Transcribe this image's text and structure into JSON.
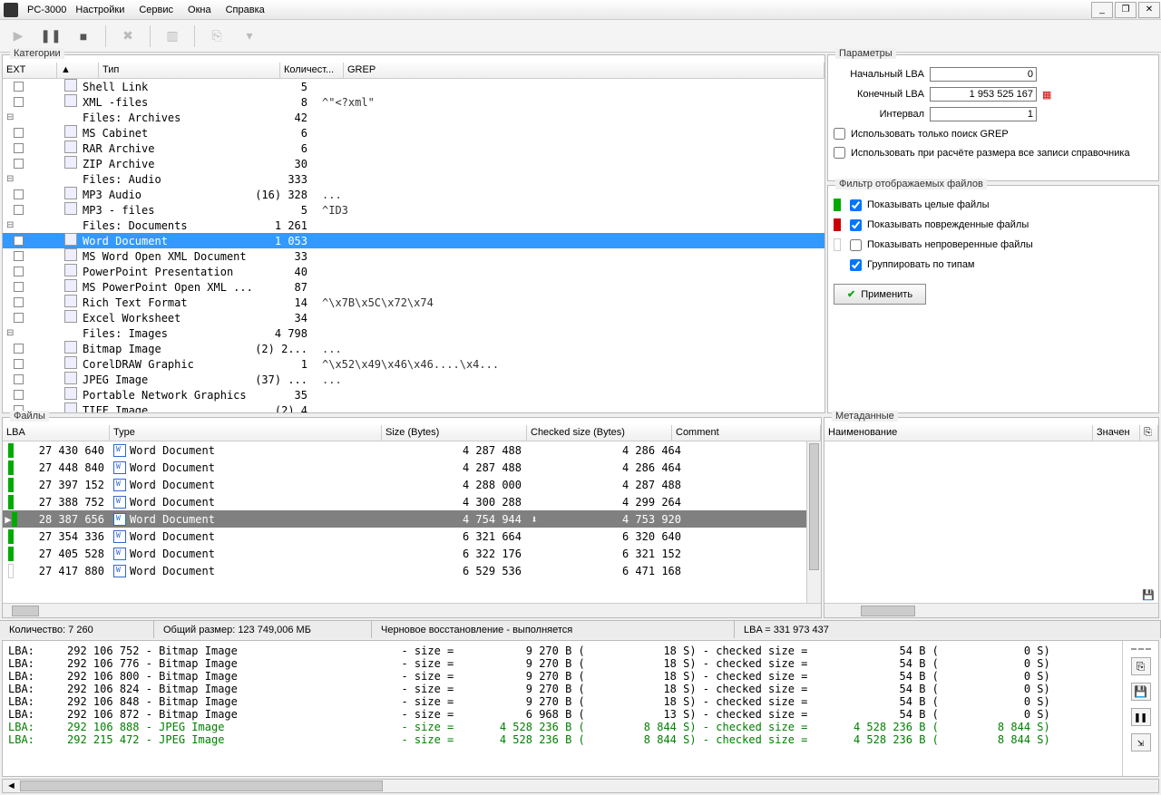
{
  "title": "PC-3000",
  "menu": [
    "Настройки",
    "Сервис",
    "Окна",
    "Справка"
  ],
  "panels": {
    "categories": "Категории",
    "parameters": "Параметры",
    "files": "Файлы",
    "metadata": "Метаданные",
    "filter": "Фильтр отображаемых файлов"
  },
  "cat_headers": {
    "ext": "EXT",
    "type": "Тип",
    "count": "Количест...",
    "grep": "GREP"
  },
  "categories": [
    {
      "lvl": 2,
      "icon": "🔗",
      "name": "Shell Link",
      "count": "5",
      "grep": ""
    },
    {
      "lvl": 2,
      "icon": "📄",
      "name": "XML -files",
      "count": "8",
      "grep": "^\"<?xml\""
    },
    {
      "lvl": 1,
      "group": true,
      "name": "Files: Archives",
      "count": "42"
    },
    {
      "lvl": 2,
      "icon": "🗜",
      "name": "MS Cabinet",
      "count": "6",
      "grep": ""
    },
    {
      "lvl": 2,
      "icon": "🗜",
      "name": "RAR Archive",
      "count": "6",
      "grep": ""
    },
    {
      "lvl": 2,
      "icon": "🗜",
      "name": "ZIP Archive",
      "count": "30",
      "grep": ""
    },
    {
      "lvl": 1,
      "group": true,
      "name": "Files: Audio",
      "count": "333"
    },
    {
      "lvl": 2,
      "icon": "♪",
      "name": "MP3 Audio",
      "count": "(16) 328",
      "grep": "..."
    },
    {
      "lvl": 2,
      "icon": "♪",
      "name": "MP3 - files",
      "count": "5",
      "grep": "^ID3"
    },
    {
      "lvl": 1,
      "group": true,
      "name": "Files: Documents",
      "count": "1 261"
    },
    {
      "lvl": 2,
      "icon": "W",
      "name": "Word Document",
      "count": "1 053",
      "grep": "",
      "selected": true
    },
    {
      "lvl": 2,
      "icon": "W",
      "name": "MS Word Open XML Document",
      "count": "33",
      "grep": ""
    },
    {
      "lvl": 2,
      "icon": "P",
      "name": "PowerPoint Presentation",
      "count": "40",
      "grep": ""
    },
    {
      "lvl": 2,
      "icon": "P",
      "name": "MS PowerPoint Open XML ...",
      "count": "87",
      "grep": ""
    },
    {
      "lvl": 2,
      "icon": "T",
      "name": "Rich Text Format",
      "count": "14",
      "grep": "^\\x7B\\x5C\\x72\\x74"
    },
    {
      "lvl": 2,
      "icon": "X",
      "name": "Excel Worksheet",
      "count": "34",
      "grep": ""
    },
    {
      "lvl": 1,
      "group": true,
      "name": "Files: Images",
      "count": "4 798"
    },
    {
      "lvl": 2,
      "icon": "🖼",
      "name": "Bitmap Image",
      "count": "(2) 2...",
      "grep": "..."
    },
    {
      "lvl": 2,
      "icon": "🎨",
      "name": "CorelDRAW Graphic",
      "count": "1",
      "grep": "^\\x52\\x49\\x46\\x46....\\x4..."
    },
    {
      "lvl": 2,
      "icon": "🖼",
      "name": "JPEG Image",
      "count": "(37) ...",
      "grep": "..."
    },
    {
      "lvl": 2,
      "icon": "🖼",
      "name": "Portable Network Graphics",
      "count": "35",
      "grep": ""
    },
    {
      "lvl": 2,
      "icon": "🖼",
      "name": "TIFF Image",
      "count": "(2) 4",
      "grep": ""
    }
  ],
  "params": {
    "start_lba_label": "Начальный LBA",
    "start_lba": "0",
    "end_lba_label": "Конечный  LBA",
    "end_lba": "1 953 525 167",
    "interval_label": "Интервал",
    "interval": "1",
    "grep_only": "Использовать только поиск GREP",
    "all_records": "Использовать при расчёте размера все записи справочника"
  },
  "filters": {
    "whole": "Показывать целые файлы",
    "damaged": "Показывать поврежденные файлы",
    "unchecked": "Показывать непроверенные файлы",
    "group": "Группировать по типам",
    "apply": "Применить"
  },
  "file_headers": {
    "lba": "LBA",
    "type": "Type",
    "size": "Size (Bytes)",
    "csize": "Checked size (Bytes)",
    "comment": "Comment"
  },
  "files": [
    {
      "g": true,
      "lba": "27 430 640",
      "type": "Word Document",
      "size": "4 287 488",
      "csize": "4 286 464"
    },
    {
      "g": true,
      "lba": "27 448 840",
      "type": "Word Document",
      "size": "4 287 488",
      "csize": "4 286 464"
    },
    {
      "g": true,
      "lba": "27 397 152",
      "type": "Word Document",
      "size": "4 288 000",
      "csize": "4 287 488"
    },
    {
      "g": true,
      "lba": "27 388 752",
      "type": "Word Document",
      "size": "4 300 288",
      "csize": "4 299 264"
    },
    {
      "g": true,
      "lba": "28 387 656",
      "type": "Word Document",
      "size": "4 754 944",
      "csize": "4 753 920",
      "sel": true,
      "arrow": true
    },
    {
      "g": true,
      "lba": "27 354 336",
      "type": "Word Document",
      "size": "6 321 664",
      "csize": "6 320 640"
    },
    {
      "g": true,
      "lba": "27 405 528",
      "type": "Word Document",
      "size": "6 322 176",
      "csize": "6 321 152"
    },
    {
      "g": false,
      "lba": "27 417 880",
      "type": "Word Document",
      "size": "6 529 536",
      "csize": "6 471 168"
    }
  ],
  "meta_headers": {
    "name": "Наименование",
    "value": "Значен"
  },
  "status": {
    "count": "Количество: 7 260",
    "size": "Общий размер: 123 749,006 МБ",
    "op": "Черновое восстановление - выполняется",
    "lba": "LBA =     331 973 437"
  },
  "log": [
    {
      "c": "",
      "t": "LBA:     292 106 752 - Bitmap Image                         - size =           9 270 B (            18 S) - checked size =              54 B (             0 S)"
    },
    {
      "c": "",
      "t": "LBA:     292 106 776 - Bitmap Image                         - size =           9 270 B (            18 S) - checked size =              54 B (             0 S)"
    },
    {
      "c": "",
      "t": "LBA:     292 106 800 - Bitmap Image                         - size =           9 270 B (            18 S) - checked size =              54 B (             0 S)"
    },
    {
      "c": "",
      "t": "LBA:     292 106 824 - Bitmap Image                         - size =           9 270 B (            18 S) - checked size =              54 B (             0 S)"
    },
    {
      "c": "",
      "t": "LBA:     292 106 848 - Bitmap Image                         - size =           9 270 B (            18 S) - checked size =              54 B (             0 S)"
    },
    {
      "c": "",
      "t": "LBA:     292 106 872 - Bitmap Image                         - size =           6 968 B (            13 S) - checked size =              54 B (             0 S)"
    },
    {
      "c": "g",
      "t": "LBA:     292 106 888 - JPEG Image                           - size =       4 528 236 B (         8 844 S) - checked size =       4 528 236 B (         8 844 S)"
    },
    {
      "c": "g",
      "t": "LBA:     292 215 472 - JPEG Image                           - size =       4 528 236 B (         8 844 S) - checked size =       4 528 236 B (         8 844 S)"
    }
  ]
}
